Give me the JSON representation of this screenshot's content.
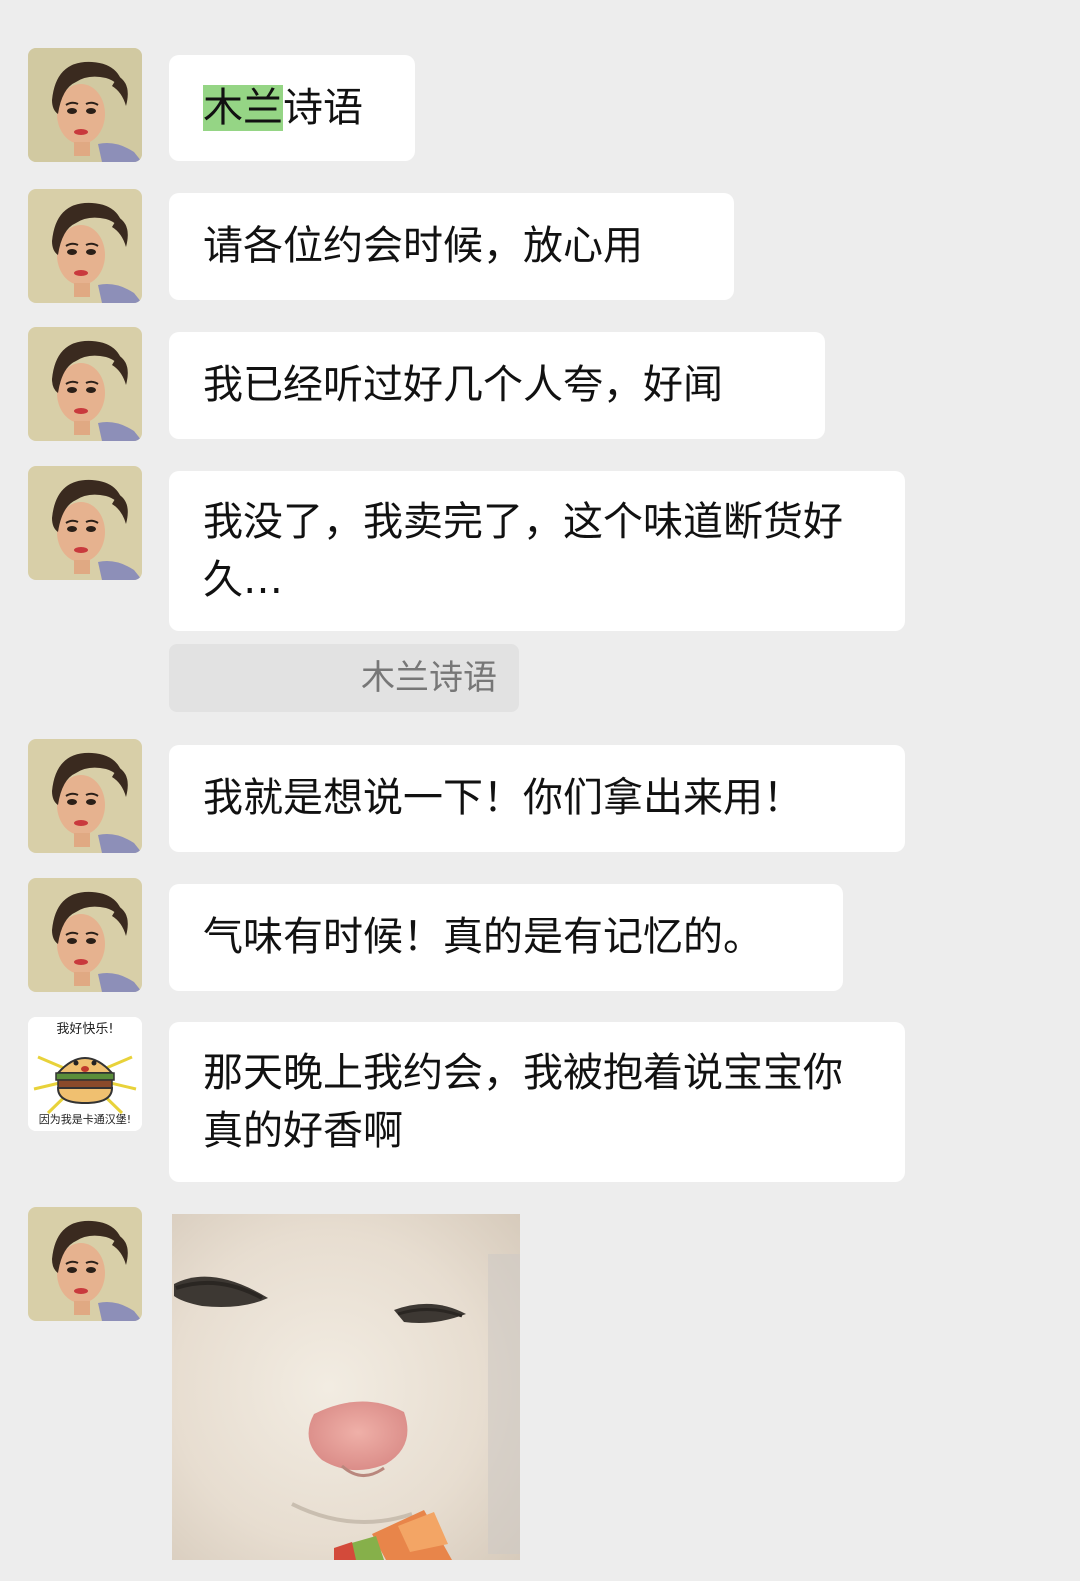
{
  "messages": [
    {
      "highlight": "木兰",
      "rest": "诗语"
    },
    {
      "text": "请各位约会时候，放心用"
    },
    {
      "text": "我已经听过好几个人夸，好闻"
    },
    {
      "text": "我没了，我卖完了，这个味道断货好久…"
    },
    {
      "quote": "木兰诗语"
    },
    {
      "text": "我就是想说一下！你们拿出来用！"
    },
    {
      "text": "气味有时候！真的是有记忆的。"
    },
    {
      "text": "那天晚上我约会，我被抱着说宝宝你真的好香啊"
    }
  ],
  "sticker_avatar": {
    "top_text": "我好快乐!",
    "bottom_text": "因为我是卡通汉堡!"
  },
  "icons": {
    "user_avatar": "woman-portrait-avatar",
    "other_avatar": "cartoon-burger-avatar",
    "image": "cat-photo"
  }
}
